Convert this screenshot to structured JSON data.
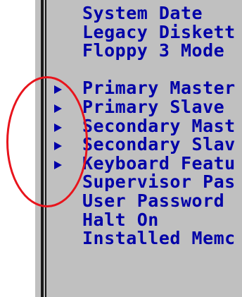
{
  "bios_menu": {
    "items": [
      {
        "label": "System Date",
        "submenu": false
      },
      {
        "label": "Legacy Diskett",
        "submenu": false
      },
      {
        "label": "Floppy 3 Mode",
        "submenu": false
      },
      {
        "label": "",
        "submenu": false
      },
      {
        "label": "Primary Master",
        "submenu": true
      },
      {
        "label": "Primary Slave",
        "submenu": true
      },
      {
        "label": "Secondary Mast",
        "submenu": true
      },
      {
        "label": "Secondary Slav",
        "submenu": true
      },
      {
        "label": "Keyboard Featu",
        "submenu": true
      },
      {
        "label": "Supervisor Pas",
        "submenu": false
      },
      {
        "label": "User Password",
        "submenu": false
      },
      {
        "label": "Halt On",
        "submenu": false
      },
      {
        "label": "Installed Memc",
        "submenu": false
      }
    ]
  },
  "colors": {
    "text": "#0000a8",
    "panel_background": "#c0c0c0",
    "annotation": "#e8141c"
  }
}
